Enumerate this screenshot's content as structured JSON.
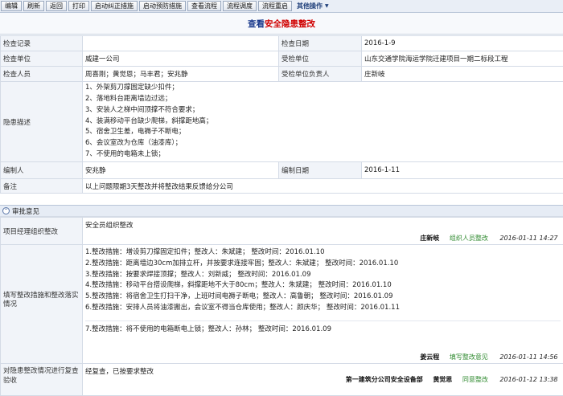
{
  "toolbar": {
    "buttons": [
      "编辑",
      "刷新",
      "返回",
      "打印",
      "启动纠正措施",
      "启动预防措施",
      "查看流程",
      "流程调度",
      "流程重启"
    ],
    "other_label": "其他操作"
  },
  "page_title": {
    "prefix": "查看",
    "highlight": "安全隐患整改"
  },
  "info": {
    "check_record_label": "检查记录",
    "check_record_value": "",
    "check_date_label": "检查日期",
    "check_date_value": "2016-1-9",
    "check_unit_label": "检查单位",
    "check_unit_value": "威建一公司",
    "inspected_unit_label": "受检单位",
    "inspected_unit_value": "山东交通学院海运学院迁建项目一期二标段工程",
    "inspectors_label": "检查人员",
    "inspectors_value": "周喜刚；黄觉恩；马丰君；安兆静",
    "inspected_head_label": "受检单位负责人",
    "inspected_head_value": "庄新岐",
    "hazard_label": "隐患描述",
    "hazard_items": [
      "1、外架剪刀撑固定缺少扣件；",
      "2、落地料台距离墙边过远；",
      "3、安装人之梯中间顶撑不符合要求；",
      "4、装满移动平台缺少爬梯，斜撑距地高；",
      "5、宿舍卫生差，电褥子不断电；",
      "6、会议室改为仓库（油漆库）；",
      "7、不使用的电箱未上锁；"
    ],
    "compiler_label": "编制人",
    "compiler_value": "安兆静",
    "compile_date_label": "编制日期",
    "compile_date_value": "2016-1-11",
    "remark_label": "备注",
    "remark_value": "以上问题限期3天整改并将整改结果反馈给分公司"
  },
  "approval": {
    "section_title": "审批意见",
    "rows": [
      {
        "label": "项目经理组织整改",
        "content": [
          "安全员组织整改"
        ],
        "signer": "庄新岐",
        "action": "组织人员整改",
        "time": "2016-01-11 14:27"
      },
      {
        "label": "填写整改措施和整改落实情况",
        "content": [
          "1.整改措施：增设剪刀撑固定扣件；整改人：朱斌建；  整改时间：2016.01.10",
          "2.整改措施：距离墙边30cm加排立杆，并按要求连接牢固；整改人：朱斌建；  整改时间：2016.01.10",
          "3.整改措施：按要求焊接顶撑；整改人：刘新威；  整改时间：2016.01.09",
          "4.整改措施：移动平台搭设爬梯，斜撑距地不大于80cm；整改人：朱斌建；  整改时间：2016.01.10",
          "5.整改措施：将宿舍卫生打扫干净，上班时间电褥子断电；整改人：高鲁朝；  整改时间：2016.01.09",
          "6.整改措施：安排人员将油漆搬出，会议室不得当仓库使用；整改人：颜庆华；  整改时间：2016.01.11"
        ],
        "content2": [
          "7.整改措施：将不使用的电箱断电上锁；整改人：孙林；  整改时间：2016.01.09"
        ],
        "signer": "姜云程",
        "action": "填写整改意见",
        "time": "2016-01-11 14:56"
      },
      {
        "label": "对隐患整改情况进行复查验收",
        "content": [
          "经复查，已按要求整改"
        ],
        "signer_unit": "第一建筑分公司安全设备部",
        "signer": "黄觉恩",
        "action": "同意整改",
        "time": "2016-01-12 13:38"
      }
    ]
  }
}
